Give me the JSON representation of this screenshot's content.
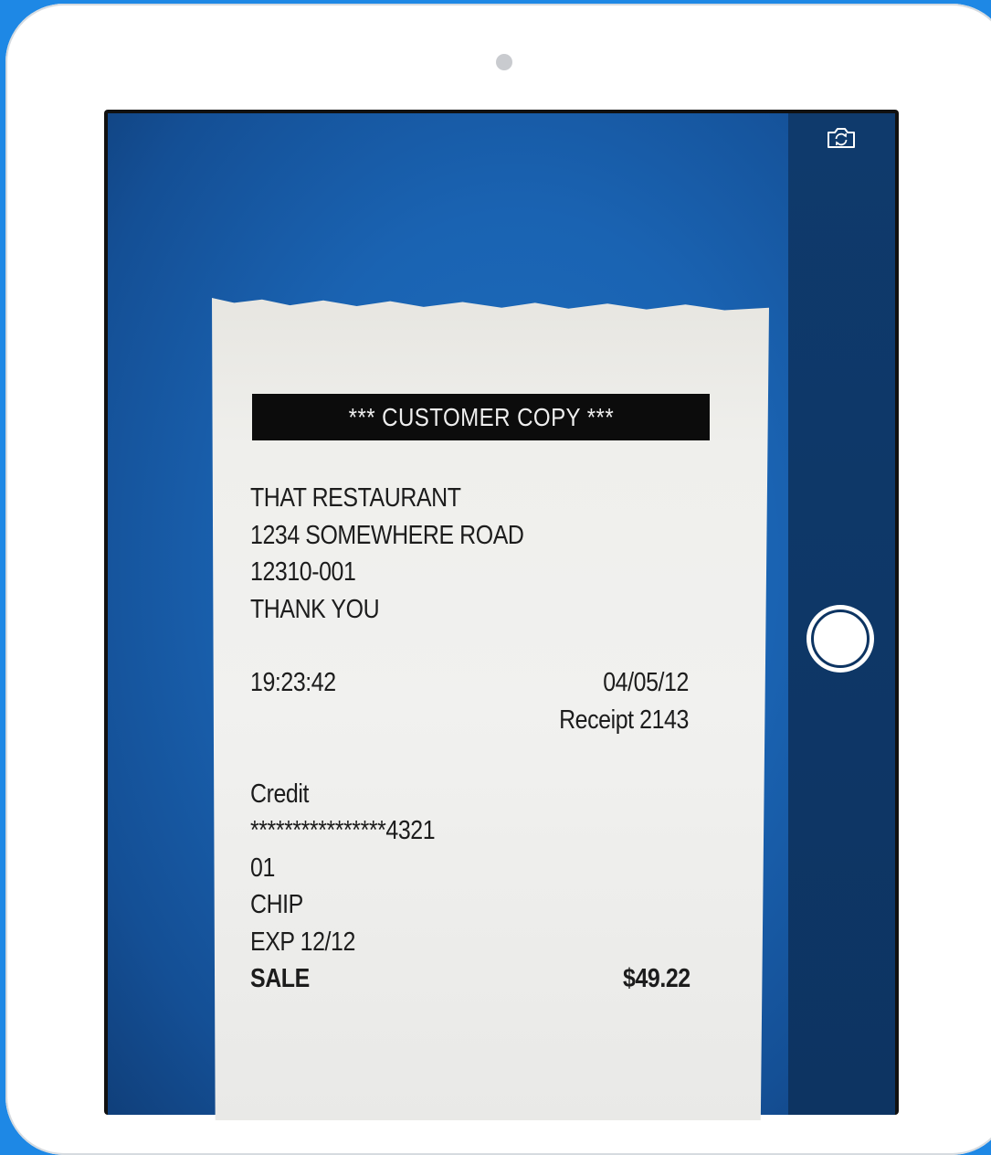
{
  "camera": {
    "flip_icon": "camera-flip-icon",
    "shutter_icon": "shutter-circle-icon"
  },
  "receipt": {
    "banner": "*** CUSTOMER COPY ***",
    "merchant_name": "THAT RESTAURANT",
    "address": "1234 SOMEWHERE ROAD",
    "merchant_id": "12310-001",
    "greeting": "THANK YOU",
    "time": "19:23:42",
    "date": "04/05/12",
    "receipt_number": "Receipt 2143",
    "payment_type": "Credit",
    "card_number": "****************4321",
    "entry_code": "01",
    "entry_method": "CHIP",
    "expiry": "EXP 12/12",
    "sale_label": "SALE",
    "sale_amount": "$49.22"
  },
  "colors": {
    "background": "#1e88e5",
    "viewfinder": "#1a63b2",
    "control_panel": "#0d3462"
  }
}
